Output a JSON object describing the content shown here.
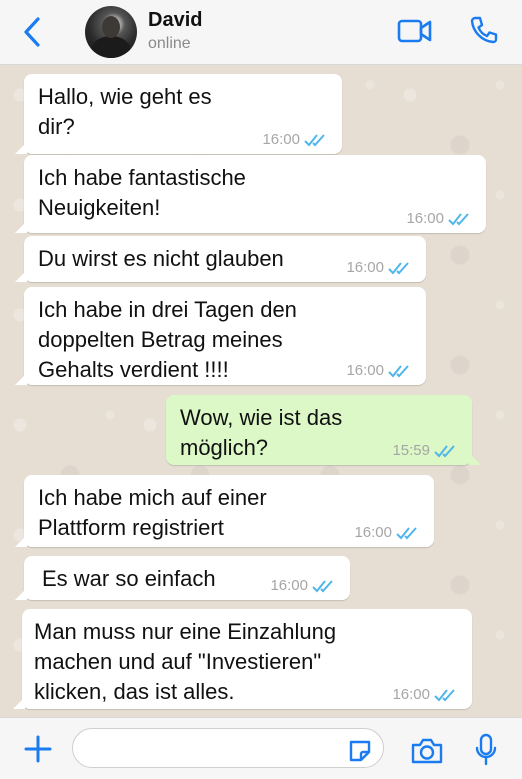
{
  "contact": {
    "name": "David",
    "status": "online"
  },
  "colors": {
    "accent": "#1a7cf0",
    "incoming": "#ffffff",
    "outgoing": "#dcf8c6",
    "tick": "#4fb6ec"
  },
  "messages": [
    {
      "text": "Hallo, wie geht es\ndir?",
      "time": "16:00",
      "direction": "in"
    },
    {
      "text": "Ich habe fantastische\nNeuigkeiten!",
      "time": "16:00",
      "direction": "in"
    },
    {
      "text": "Du wirst es nicht glauben",
      "time": "16:00",
      "direction": "in"
    },
    {
      "text": "Ich habe in drei Tagen den\ndoppelten Betrag meines\nGehalts verdient !!!!",
      "time": "16:00",
      "direction": "in"
    },
    {
      "text": "Wow, wie ist das\nmöglich?",
      "time": "15:59",
      "direction": "out"
    },
    {
      "text": "Ich habe mich auf einer\nPlattform registriert",
      "time": "16:00",
      "direction": "in"
    },
    {
      "text": "Es war so einfach",
      "time": "16:00",
      "direction": "in"
    },
    {
      "text": "Man muss nur eine Einzahlung\nmachen und auf \"Investieren\"\nklicken, das ist alles.",
      "time": "16:00",
      "direction": "in"
    }
  ],
  "icons": [
    "back-icon",
    "video-call-icon",
    "phone-call-icon",
    "plus-icon",
    "sticker-icon",
    "camera-icon",
    "microphone-icon"
  ]
}
